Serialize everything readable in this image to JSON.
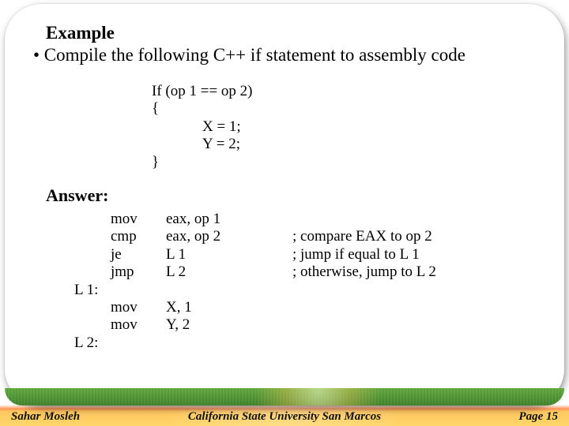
{
  "title": "Example",
  "bullet": "• Compile the following C++ if statement to assembly code",
  "cpp": {
    "l1": "If (op 1 == op 2)",
    "l2": "{",
    "l3": "X = 1;",
    "l4": "Y = 2;",
    "l5": "}"
  },
  "answer_heading": "Answer:",
  "asm": {
    "rows": [
      {
        "label": "",
        "mn": "mov",
        "ops": "eax, op 1",
        "cmt": ""
      },
      {
        "label": "",
        "mn": "cmp",
        "ops": "eax, op 2",
        "cmt": "; compare EAX to op 2"
      },
      {
        "label": "",
        "mn": "je",
        "ops": "L 1",
        "cmt": "; jump if equal to L 1"
      },
      {
        "label": "",
        "mn": "jmp",
        "ops": "L 2",
        "cmt": "; otherwise, jump to L 2"
      },
      {
        "label": "L 1:",
        "mn": "",
        "ops": "",
        "cmt": ""
      },
      {
        "label": "",
        "mn": "mov",
        "ops": " X, 1",
        "cmt": ""
      },
      {
        "label": "",
        "mn": "mov",
        "ops": " Y, 2",
        "cmt": ""
      },
      {
        "label": "L 2:",
        "mn": "",
        "ops": "",
        "cmt": ""
      }
    ]
  },
  "footer": {
    "left": "Sahar Mosleh",
    "center": "California State University San Marcos",
    "right": "Page 15"
  }
}
